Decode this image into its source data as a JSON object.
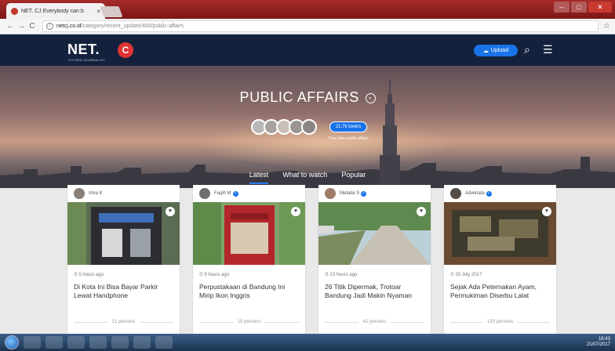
{
  "browser": {
    "tab_title": "NET. CJ Everybody can b",
    "close_glyph": "×",
    "url_domain": "netcj.co.id",
    "url_path": "/category/recent_update/460/public-affairs"
  },
  "header": {
    "logo_text": "NET.",
    "logo_badge": "C",
    "logo_subtitle": "CITIZEN JOURNALIST",
    "upload_label": "Upload",
    "search_icon": "search-icon",
    "menu_icon": "menu-icon"
  },
  "hero": {
    "title": "PUBLIC AFFAIRS",
    "lovers_badge": "21.7k lovers",
    "lovers_sub": "They love public-affairs",
    "tabs": [
      {
        "label": "Latest",
        "active": true
      },
      {
        "label": "What to watch",
        "active": false
      },
      {
        "label": "Popular",
        "active": false
      }
    ]
  },
  "cards": [
    {
      "author": "Irma K",
      "verified": false,
      "time": "5 hours ago",
      "headline": "Di Kota Ini Bisa Bayar Parkir Lewat Handphone",
      "persons": "21 persons"
    },
    {
      "author": "Faqih M",
      "verified": true,
      "time": "9 hours ago",
      "headline": "Perpustakaan di Bandung Ini Mirip Ikon Inggris",
      "persons": "15 persons"
    },
    {
      "author": "Metalia S",
      "verified": true,
      "time": "23 hours ago",
      "headline": "26 Titik Dipermak, Trotoar Bandung Jadi Makin Nyaman",
      "persons": "41 persons"
    },
    {
      "author": "Adwinata",
      "verified": true,
      "time": "20 July 2017",
      "headline": "Sejak Ada Peternakan Ayam, Permukiman Diserbu Lalat",
      "persons": "120 persons"
    }
  ],
  "taskbar": {
    "clock_time": "16:43",
    "clock_date": "21/07/2017"
  }
}
